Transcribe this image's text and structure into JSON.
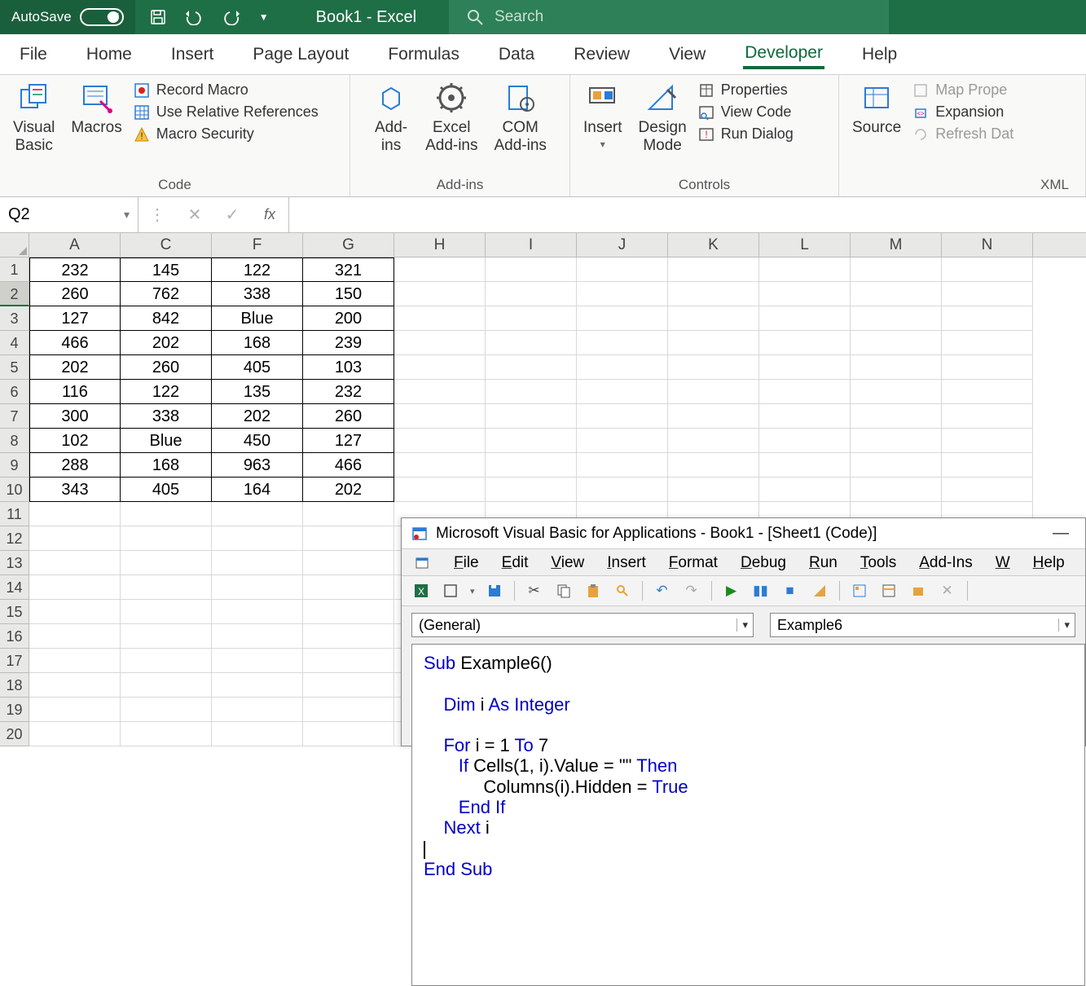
{
  "titlebar": {
    "autosave_label": "AutoSave",
    "autosave_state": "Off",
    "doc_title": "Book1 - Excel",
    "search_placeholder": "Search"
  },
  "ribbon_tabs": [
    "File",
    "Home",
    "Insert",
    "Page Layout",
    "Formulas",
    "Data",
    "Review",
    "View",
    "Developer",
    "Help"
  ],
  "ribbon_active_tab": "Developer",
  "ribbon": {
    "code": {
      "visual_basic": "Visual\nBasic",
      "macros": "Macros",
      "record_macro": "Record Macro",
      "use_relative": "Use Relative References",
      "macro_security": "Macro Security",
      "group_label": "Code"
    },
    "addins": {
      "addins": "Add-\nins",
      "excel_addins": "Excel\nAdd-ins",
      "com_addins": "COM\nAdd-ins",
      "group_label": "Add-ins"
    },
    "controls": {
      "insert": "Insert",
      "design_mode": "Design\nMode",
      "properties": "Properties",
      "view_code": "View Code",
      "run_dialog": "Run Dialog",
      "group_label": "Controls"
    },
    "xml": {
      "source": "Source",
      "map_props": "Map Prope",
      "expansion": "Expansion ",
      "refresh": "Refresh Dat",
      "group_label": "XML"
    }
  },
  "formula_bar": {
    "name_box": "Q2",
    "fx_label": "fx"
  },
  "grid": {
    "col_widths": {
      "A": 112,
      "C": 112,
      "F": 112,
      "G": 112,
      "H": 112,
      "I": 112,
      "J": 112,
      "K": 112,
      "L": 112,
      "M": 112,
      "N": 112
    },
    "columns": [
      "A",
      "C",
      "F",
      "G",
      "H",
      "I",
      "J",
      "K",
      "L",
      "M",
      "N"
    ],
    "selected_row_header": 2,
    "rows": [
      {
        "n": 1,
        "cells": [
          "232",
          "145",
          "122",
          "321"
        ]
      },
      {
        "n": 2,
        "cells": [
          "260",
          "762",
          "338",
          "150"
        ]
      },
      {
        "n": 3,
        "cells": [
          "127",
          "842",
          "Blue",
          "200"
        ]
      },
      {
        "n": 4,
        "cells": [
          "466",
          "202",
          "168",
          "239"
        ]
      },
      {
        "n": 5,
        "cells": [
          "202",
          "260",
          "405",
          "103"
        ]
      },
      {
        "n": 6,
        "cells": [
          "116",
          "122",
          "135",
          "232"
        ]
      },
      {
        "n": 7,
        "cells": [
          "300",
          "338",
          "202",
          "260"
        ]
      },
      {
        "n": 8,
        "cells": [
          "102",
          "Blue",
          "450",
          "127"
        ]
      },
      {
        "n": 9,
        "cells": [
          "288",
          "168",
          "963",
          "466"
        ]
      },
      {
        "n": 10,
        "cells": [
          "343",
          "405",
          "164",
          "202"
        ]
      },
      {
        "n": 11,
        "cells": []
      },
      {
        "n": 12,
        "cells": []
      },
      {
        "n": 13,
        "cells": []
      },
      {
        "n": 14,
        "cells": []
      },
      {
        "n": 15,
        "cells": []
      },
      {
        "n": 16,
        "cells": []
      },
      {
        "n": 17,
        "cells": []
      },
      {
        "n": 18,
        "cells": []
      },
      {
        "n": 19,
        "cells": []
      },
      {
        "n": 20,
        "cells": []
      }
    ]
  },
  "vba": {
    "title": "Microsoft Visual Basic for Applications - Book1 - [Sheet1 (Code)]",
    "menus": [
      "File",
      "Edit",
      "View",
      "Insert",
      "Format",
      "Debug",
      "Run",
      "Tools",
      "Add-Ins",
      "W",
      "Help"
    ],
    "dd_left": "(General)",
    "dd_right": "Example6",
    "code_tokens": [
      [
        {
          "t": "Sub ",
          "k": true
        },
        {
          "t": "Example6()"
        }
      ],
      [],
      [
        {
          "t": "    "
        },
        {
          "t": "Dim ",
          "k": true
        },
        {
          "t": "i "
        },
        {
          "t": "As Integer",
          "k": true
        }
      ],
      [],
      [
        {
          "t": "    "
        },
        {
          "t": "For ",
          "k": true
        },
        {
          "t": "i = 1 "
        },
        {
          "t": "To ",
          "k": true
        },
        {
          "t": "7"
        }
      ],
      [
        {
          "t": "       "
        },
        {
          "t": "If ",
          "k": true
        },
        {
          "t": "Cells(1, i).Value = \"\" "
        },
        {
          "t": "Then",
          "k": true
        }
      ],
      [
        {
          "t": "            Columns(i).Hidden = "
        },
        {
          "t": "True",
          "k": true
        }
      ],
      [
        {
          "t": "       "
        },
        {
          "t": "End If",
          "k": true
        }
      ],
      [
        {
          "t": "    "
        },
        {
          "t": "Next ",
          "k": true
        },
        {
          "t": "i"
        }
      ],
      [
        {
          "t": "    ",
          "cursor": true
        }
      ],
      [
        {
          "t": "End Sub",
          "k": true
        }
      ]
    ]
  }
}
